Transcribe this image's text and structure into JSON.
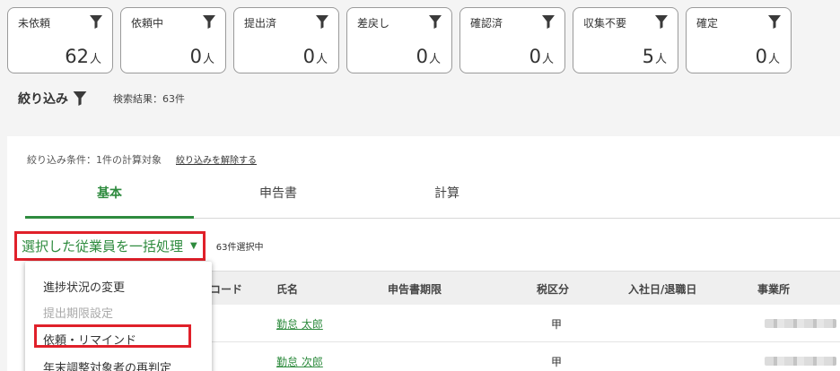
{
  "status_cards": [
    {
      "label": "未依頼",
      "count": "62",
      "unit": "人"
    },
    {
      "label": "依頼中",
      "count": "0",
      "unit": "人"
    },
    {
      "label": "提出済",
      "count": "0",
      "unit": "人"
    },
    {
      "label": "差戻し",
      "count": "0",
      "unit": "人"
    },
    {
      "label": "確認済",
      "count": "0",
      "unit": "人"
    },
    {
      "label": "収集不要",
      "count": "5",
      "unit": "人"
    },
    {
      "label": "確定",
      "count": "0",
      "unit": "人"
    }
  ],
  "filter": {
    "label": "絞り込み",
    "result": "検索結果：63件"
  },
  "conditions": {
    "text": "絞り込み条件：1件の計算対象",
    "clear_link": "絞り込みを解除する"
  },
  "tabs": [
    {
      "label": "基本",
      "active": true
    },
    {
      "label": "申告書",
      "active": false
    },
    {
      "label": "計算",
      "active": false
    }
  ],
  "bulk": {
    "button_label": "選択した従業員を一括処理",
    "selected_count": "63件選択中"
  },
  "table": {
    "columns": [
      "コード",
      "氏名",
      "申告書期限",
      "税区分",
      "入社日/退職日",
      "事業所"
    ],
    "rows": [
      {
        "name": "勤怠 太郎",
        "tax_class": "甲"
      },
      {
        "name": "勤怠 次郎",
        "tax_class": "甲"
      }
    ]
  },
  "dropdown": {
    "items": [
      {
        "label": "進捗状況の変更",
        "disabled": false
      },
      {
        "label": "提出期限設定",
        "disabled": true
      },
      {
        "label": "依頼・リマインド",
        "disabled": false
      },
      {
        "label": "年末調整対象者の再判定",
        "disabled": false
      }
    ]
  },
  "colors": {
    "accent_green": "#2e8b3e",
    "highlight_red": "#e0202a"
  }
}
